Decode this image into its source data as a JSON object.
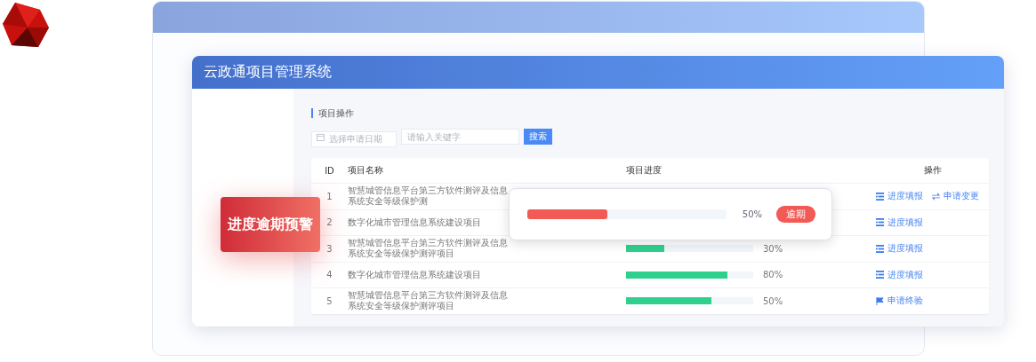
{
  "window": {
    "title": "云政通项目管理系统"
  },
  "section": {
    "title": "项目操作"
  },
  "filters": {
    "date_placeholder": "选择申请日期",
    "keyword_placeholder": "请输入关键字",
    "search_button": "搜索"
  },
  "table": {
    "columns": [
      "ID",
      "项目名称",
      "项目进度",
      "操作"
    ],
    "rows": [
      {
        "id": "1",
        "name": "智慧城管信息平台第三方软件测评及信息系统安全等级保护测",
        "actions": [
          {
            "kind": "report",
            "label": "进度填报"
          },
          {
            "kind": "change",
            "label": "申请变更"
          }
        ]
      },
      {
        "id": "2",
        "name": "数字化城市管理信息系统建设项目",
        "actions": [
          {
            "kind": "report",
            "label": "进度填报"
          }
        ]
      },
      {
        "id": "3",
        "name": "智慧城管信息平台第三方软件测评及信息系统安全等级保护测评项目",
        "level": 0.3,
        "percent": "30%",
        "actions": [
          {
            "kind": "report",
            "label": "进度填报"
          }
        ]
      },
      {
        "id": "4",
        "name": "数字化城市管理信息系统建设项目",
        "level": 0.8,
        "percent": "80%",
        "actions": [
          {
            "kind": "report",
            "label": "进度填报"
          }
        ]
      },
      {
        "id": "5",
        "name": "智慧城管信息平台第三方软件测评及信息系统安全等级保护测评项目",
        "level": 0.67,
        "percent": "50%",
        "actions": [
          {
            "kind": "accept",
            "label": "申请终验"
          }
        ]
      }
    ]
  },
  "popup": {
    "level": 0.4,
    "percent": "50%",
    "badge": "逾期"
  },
  "warning_label": "进度逾期预警"
}
